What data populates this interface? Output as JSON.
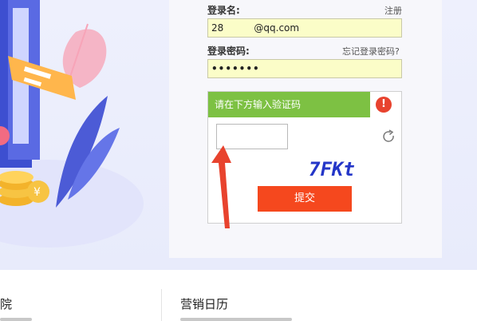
{
  "login": {
    "username_label": "登录名:",
    "register_link": "注册",
    "username_value": "28          @qq.com",
    "password_label": "登录密码:",
    "forgot_link": "忘记登录密码?",
    "password_value": "•••••••"
  },
  "captcha": {
    "prompt": "请在下方输入验证码",
    "warning_symbol": "!",
    "input_value": "",
    "code_text": "7FKt",
    "submit_label": "提交"
  },
  "footer": {
    "left_title": "院",
    "right_title": "营销日历"
  },
  "colors": {
    "field_bg": "#fbfdc8",
    "captcha_header": "#7dc143",
    "warning": "#e8432e",
    "submit": "#f5481e",
    "arrow": "#e8432e"
  }
}
